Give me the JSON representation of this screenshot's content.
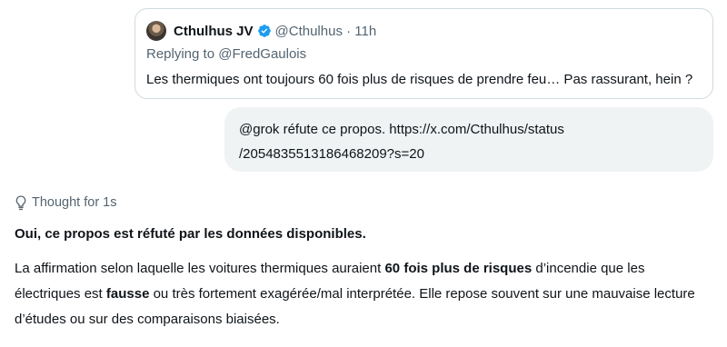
{
  "quoted_post": {
    "author_name": "Cthulhus JV",
    "handle_time": "@Cthulhus · 11h",
    "replying_to": "Replying to @FredGaulois",
    "text": "Les thermiques ont toujours 60 fois plus de risques de prendre feu… Pas rassurant, hein ?"
  },
  "user_message": {
    "line1": "@grok réfute ce propos. https://x.com/Cthulhus/status",
    "line2": "/2054835513186468209?s=20"
  },
  "thought": {
    "label": "Thought for 1s"
  },
  "answer": {
    "heading": "Oui, ce propos est réfuté par les données disponibles.",
    "p_part1": "La affirmation selon laquelle les voitures thermiques auraient ",
    "p_bold1": "60 fois plus de risques",
    "p_part2": " d’incendie que les électriques est ",
    "p_bold2": "fausse",
    "p_part3": " ou très fortement exagérée/mal interprétée. Elle repose souvent sur une mauvaise lecture d’études ou sur des comparaisons biaisées."
  },
  "colors": {
    "verified_blue": "#1d9bf0",
    "secondary_text": "#536471",
    "bubble_bg": "#eff3f4",
    "card_border": "#cfd9de"
  },
  "icons": [
    "verified-badge-icon",
    "lightbulb-icon"
  ]
}
